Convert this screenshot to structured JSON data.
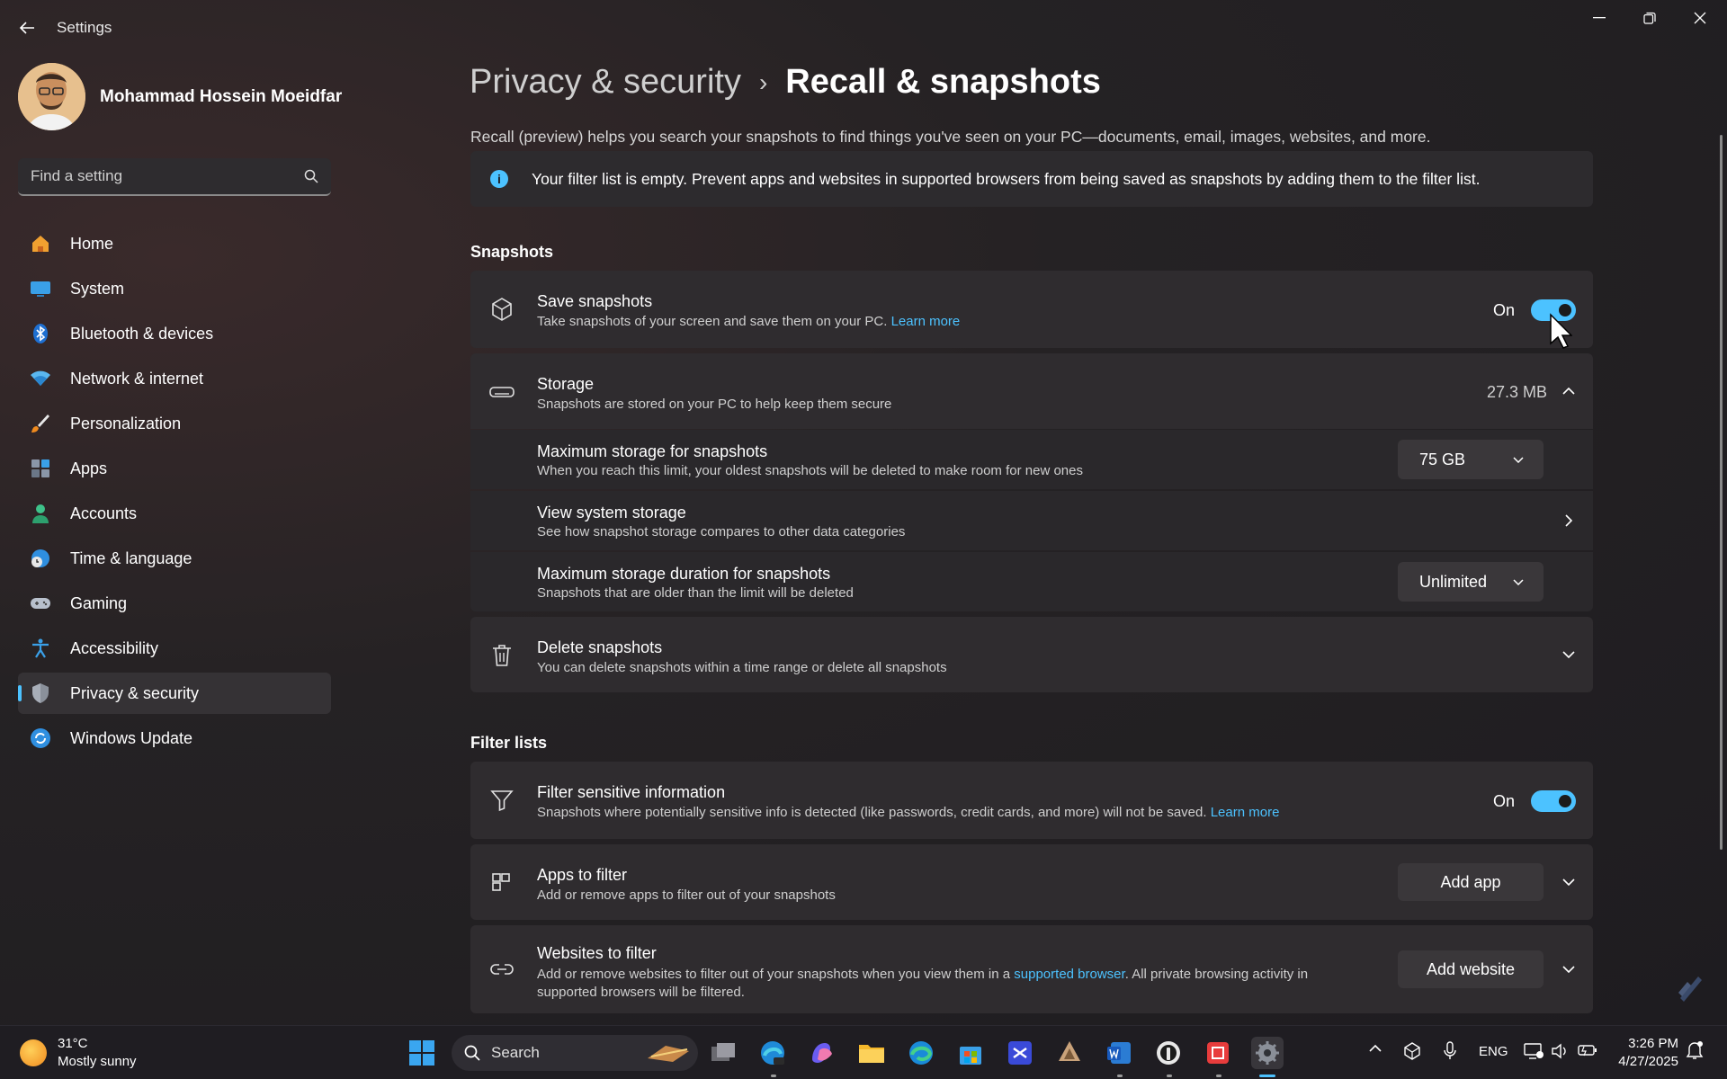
{
  "window": {
    "app_title": "Settings",
    "colors": {
      "accent": "#4cc2ff"
    }
  },
  "profile": {
    "name": "Mohammad Hossein Moeidfar"
  },
  "search": {
    "placeholder": "Find a setting"
  },
  "nav": {
    "items": [
      {
        "label": "Home",
        "icon": "home-icon"
      },
      {
        "label": "System",
        "icon": "system-icon"
      },
      {
        "label": "Bluetooth & devices",
        "icon": "bluetooth-icon"
      },
      {
        "label": "Network & internet",
        "icon": "wifi-icon"
      },
      {
        "label": "Personalization",
        "icon": "brush-icon"
      },
      {
        "label": "Apps",
        "icon": "apps-icon"
      },
      {
        "label": "Accounts",
        "icon": "accounts-icon"
      },
      {
        "label": "Time & language",
        "icon": "globe-clock-icon"
      },
      {
        "label": "Gaming",
        "icon": "gamepad-icon"
      },
      {
        "label": "Accessibility",
        "icon": "accessibility-icon"
      },
      {
        "label": "Privacy & security",
        "icon": "shield-icon",
        "active": true
      },
      {
        "label": "Windows Update",
        "icon": "update-icon"
      }
    ]
  },
  "breadcrumb": {
    "parent": "Privacy & security",
    "separator": "›",
    "current": "Recall & snapshots"
  },
  "intro": "Recall (preview) helps you search your snapshots to find things you've seen on your PC—documents, email, images, websites, and more.",
  "info_bar": {
    "text": "Your filter list is empty. Prevent apps and websites in supported browsers from being saved as snapshots by adding them to the filter list."
  },
  "snapshots_section": {
    "title": "Snapshots",
    "save": {
      "title": "Save snapshots",
      "desc": "Take snapshots of your screen and save them on your PC.",
      "link": "Learn more",
      "toggle_label": "On",
      "toggle_on": true
    },
    "storage": {
      "title": "Storage",
      "desc": "Snapshots are stored on your PC to help keep them secure",
      "value": "27.3 MB",
      "max_storage": {
        "title": "Maximum storage for snapshots",
        "desc": "When you reach this limit, your oldest snapshots will be deleted to make room for new ones",
        "selected": "75 GB"
      },
      "view_system": {
        "title": "View system storage",
        "desc": "See how snapshot storage compares to other data categories"
      },
      "max_duration": {
        "title": "Maximum storage duration for snapshots",
        "desc": "Snapshots that are older than the limit will be deleted",
        "selected": "Unlimited"
      }
    },
    "delete": {
      "title": "Delete snapshots",
      "desc": "You can delete snapshots within a time range or delete all snapshots"
    }
  },
  "filter_section": {
    "title": "Filter lists",
    "sensitive": {
      "title": "Filter sensitive information",
      "desc": "Snapshots where potentially sensitive info is detected (like passwords, credit cards, and more) will not be saved.",
      "link": "Learn more",
      "toggle_label": "On",
      "toggle_on": true
    },
    "apps": {
      "title": "Apps to filter",
      "desc": "Add or remove apps to filter out of your snapshots",
      "button": "Add app"
    },
    "websites": {
      "title": "Websites to filter",
      "desc_before": "Add or remove websites to filter out of your snapshots when you view them in a",
      "desc_link": "supported browser",
      "desc_after": ". All private browsing activity in",
      "desc_line2": "supported browsers will be filtered.",
      "button": "Add website"
    }
  },
  "taskbar": {
    "weather": {
      "temp": "31°C",
      "condition": "Mostly sunny"
    },
    "search_label": "Search",
    "tray": {
      "language": "ENG"
    },
    "clock": {
      "time": "3:26 PM",
      "date": "4/27/2025"
    }
  }
}
